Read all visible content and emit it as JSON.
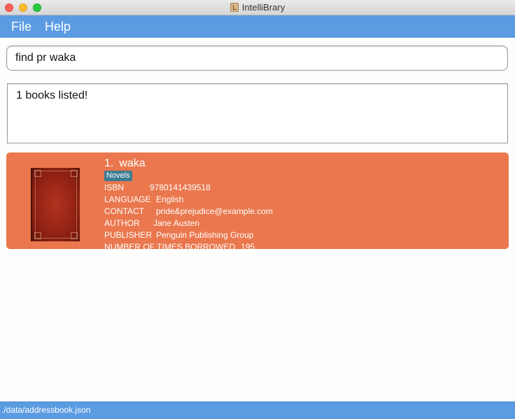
{
  "window": {
    "title": "IntelliBrary"
  },
  "menu": {
    "file": "File",
    "help": "Help"
  },
  "command": {
    "value": "find pr waka"
  },
  "result": {
    "text": "1 books listed!"
  },
  "book": {
    "index": "1.",
    "title": "waka",
    "tag": "Novels",
    "fields": {
      "isbn_label": "ISBN",
      "isbn": "9780141439518",
      "language_label": "LANGUAGE",
      "language": "English",
      "contact_label": "CONTACT",
      "contact": "pride&prejudice@example.com",
      "author_label": "AUTHOR",
      "author": "Jane Austen",
      "publisher_label": "PUBLISHER",
      "publisher": "Penguin Publishing Group",
      "borrowed_label": "NUMBER OF TIMES BORROWED",
      "borrowed": "195"
    }
  },
  "status": {
    "path": "./data/addressbook.json"
  },
  "colors": {
    "accent": "#5b9be2",
    "card": "#ea774d",
    "tag": "#3e7b91"
  }
}
